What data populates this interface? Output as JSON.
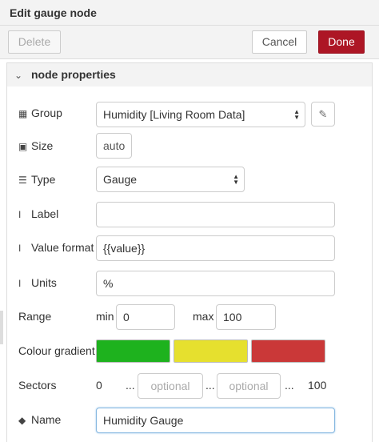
{
  "dialog": {
    "title": "Edit gauge node"
  },
  "toolbar": {
    "delete_label": "Delete",
    "cancel_label": "Cancel",
    "done_label": "Done"
  },
  "section": {
    "label": "node properties"
  },
  "form": {
    "group": {
      "label": "Group",
      "value": "Humidity [Living Room Data]"
    },
    "size": {
      "label": "Size",
      "value": "auto"
    },
    "type": {
      "label": "Type",
      "value": "Gauge"
    },
    "label": {
      "label": "Label",
      "value": ""
    },
    "value_format": {
      "label": "Value format",
      "value": "{{value}}"
    },
    "units": {
      "label": "Units",
      "value": "%"
    },
    "range": {
      "label": "Range",
      "min_label": "min",
      "min_value": "0",
      "max_label": "max",
      "max_value": "100"
    },
    "colour_gradient": {
      "label": "Colour gradient",
      "colors": [
        "#1eb21e",
        "#e6e02e",
        "#ca3838"
      ]
    },
    "sectors": {
      "label": "Sectors",
      "start": "0",
      "ellipsis": "...",
      "end": "100",
      "placeholder1": "optional",
      "placeholder2": "optional"
    },
    "name": {
      "label": "Name",
      "value": "Humidity Gauge"
    }
  },
  "icons": {
    "section": "chevron-down-icon",
    "group": "table-icon",
    "size": "resize-icon",
    "type": "list-icon",
    "label": "text-cursor-icon",
    "value_format": "text-cursor-icon",
    "units": "text-cursor-icon",
    "name": "tag-icon",
    "edit": "pencil-icon"
  }
}
